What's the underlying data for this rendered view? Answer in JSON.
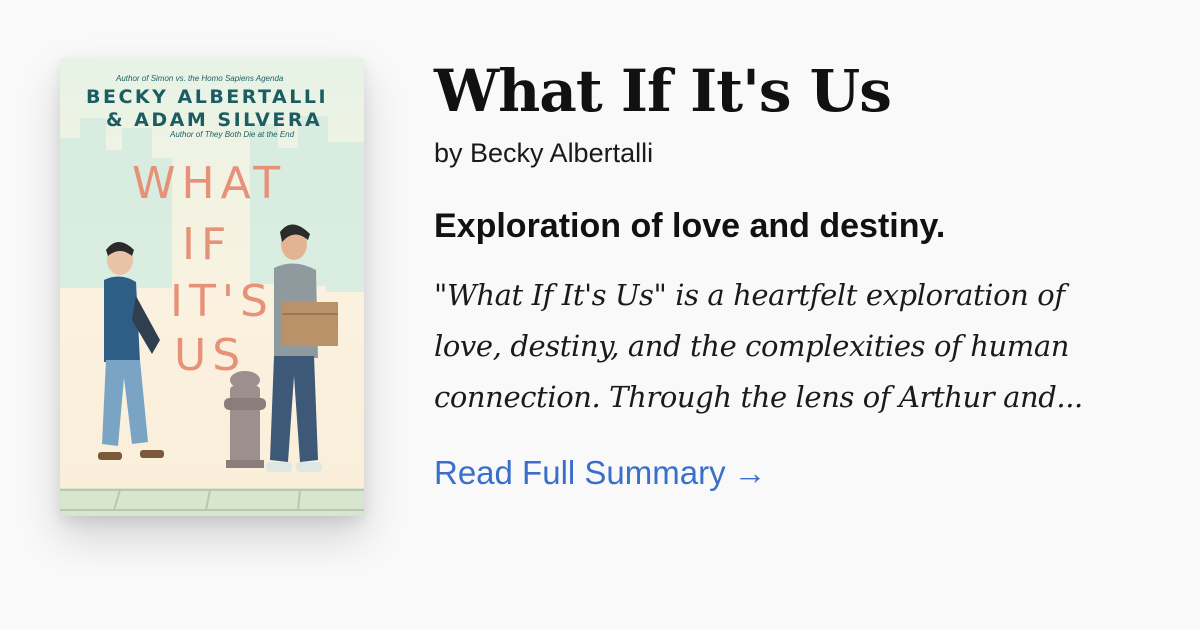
{
  "book": {
    "title": "What If It's Us",
    "byline": "by Becky Albertalli",
    "tagline": "Exploration of love and destiny.",
    "summary_lines": [
      "\"What If It's Us\" is a heartfelt exploration of",
      "love, destiny, and the complexities of human",
      "connection. Through the lens of Arthur and..."
    ],
    "read_link": {
      "label": "Read Full Summary",
      "arrow": "→"
    },
    "link_color": "#3a6fca"
  },
  "cover": {
    "tag_top": "Author of Simon vs. the Homo Sapiens Agenda",
    "author_1": "BECKY ALBERTALLI",
    "author_2": "& ADAM SILVERA",
    "tag_mid": "Author of They Both Die at the End",
    "title_words": [
      "WHAT",
      "IF",
      "IT'S",
      "US"
    ],
    "palette": {
      "teal": "#1c5d61",
      "salmon": "#e69279",
      "skyline": "#d9eee0"
    }
  }
}
